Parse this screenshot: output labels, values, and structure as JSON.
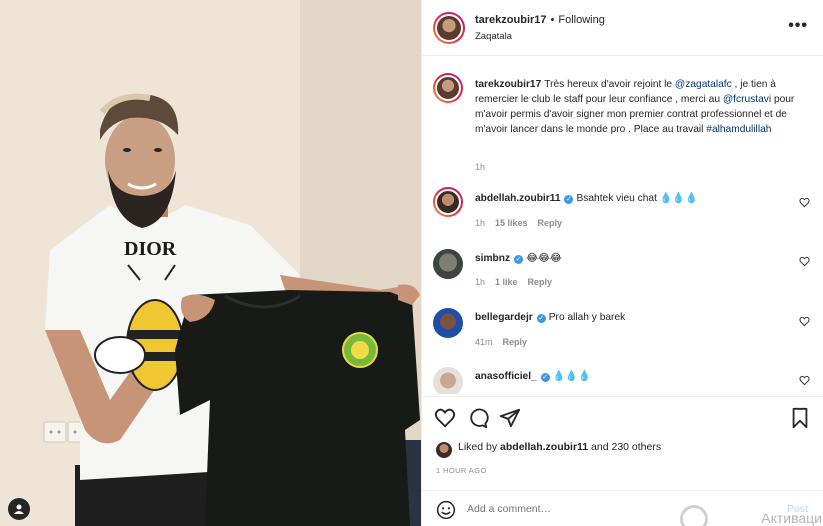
{
  "post": {
    "username": "tarekzoubir17",
    "follow_label": "Following",
    "location": "Zaqatala",
    "more_label": "•••"
  },
  "caption": {
    "username": "tarekzoubir17",
    "part1": "Très hereux d'avoir rejoint le ",
    "mention1": "@zagatalafc",
    "part2": " , je tien à remercier le club le staff pour leur confiance , merci au ",
    "mention2": "@fcrustavi",
    "part3": " pour m'avoir permis d'avoir signer mon premier contrat professionnel et de m'avoir lancer dans le monde pro . Place au travail ",
    "hashtag": "#alhamdulillah",
    "time": "1h"
  },
  "comments": [
    {
      "username": "abdellah.zoubir11",
      "verified": true,
      "text": "Bsahtek vieu chat 💧💧💧",
      "time": "1h",
      "likes": "15 likes",
      "reply": "Reply"
    },
    {
      "username": "simbnz",
      "verified": true,
      "text": "😂😂😂",
      "time": "1h",
      "likes": "1 like",
      "reply": "Reply"
    },
    {
      "username": "bellegardejr",
      "verified": true,
      "text": "Pro allah y barek",
      "time": "41m",
      "likes": "",
      "reply": "Reply"
    },
    {
      "username": "anasofficiel_",
      "verified": true,
      "text": "💧💧💧",
      "time": "",
      "likes": "",
      "reply": ""
    }
  ],
  "likes": {
    "prefix": "Liked by ",
    "user": "abdellah.zoubir11",
    "suffix": " and 230 others"
  },
  "timestamp": "1 HOUR AGO",
  "add_comment": {
    "placeholder": "Add a comment…",
    "post_label": "Post"
  },
  "watermark": "Активаци",
  "photo": {
    "shirt_print": "DIOR"
  },
  "colors": {
    "link": "#00376b",
    "verified": "#3897f0",
    "post_disabled": "#b2dffc",
    "meta": "#8e8e8e"
  }
}
